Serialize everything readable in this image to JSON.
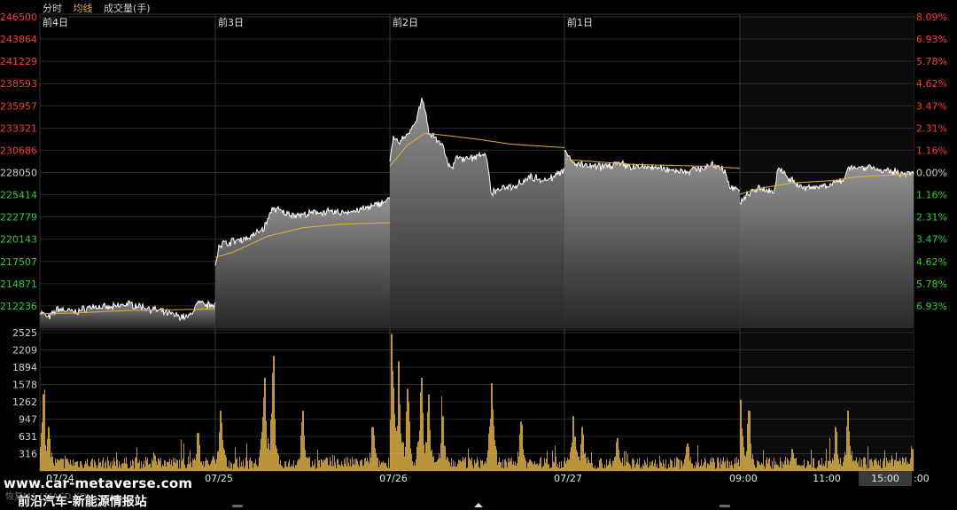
{
  "legend": {
    "tab_fenshi": "分时",
    "tab_avg": "均线",
    "tab_volume": "成交量(手)"
  },
  "colors": {
    "background": "#000000",
    "price_line": "#ffffff",
    "avg_line": "#e0b23c",
    "volume_bar": "#e8b84a",
    "up": "#ff3b3b",
    "down": "#33cc33",
    "neutral": "#cfcfcf",
    "grid": "#2a2a2a"
  },
  "watermark": {
    "line1": "www.car-metaverse.com",
    "line2": "前沿汽车-新能源情报站"
  },
  "faded_text": "恢复MA LMACD KDJ",
  "time_label": "15:00",
  "chart_data": {
    "type": "line",
    "price_axis": {
      "ylim": [
        209600,
        246500
      ],
      "ticks": [
        246500,
        243864,
        241229,
        238593,
        235957,
        233321,
        230686,
        228050,
        225414,
        222779,
        220143,
        217507,
        214871,
        212236
      ],
      "base": 228050
    },
    "pct_axis": {
      "ticks_up": [
        "8.09%",
        "6.93%",
        "5.78%",
        "4.62%",
        "3.47%",
        "2.31%",
        "1.16%"
      ],
      "zero": "0.00%",
      "ticks_down": [
        "1.16%",
        "2.31%",
        "3.47%",
        "4.62%",
        "5.78%",
        "6.93%"
      ]
    },
    "volume_axis": {
      "ylim": [
        0,
        2525
      ],
      "ticks": [
        2525,
        2209,
        1894,
        1578,
        1262,
        947,
        631,
        316
      ]
    },
    "day_labels": [
      "前4日",
      "前3日",
      "前2日",
      "前1日"
    ],
    "date_labels": [
      "07/24",
      "07/25",
      "07/26",
      "07/27"
    ],
    "intraday_labels": [
      "09:00",
      "11:00",
      "15:00"
    ],
    "trailing_label": ":00",
    "days": [
      {
        "price_path": [
          [
            0,
            211600
          ],
          [
            0.05,
            210800
          ],
          [
            0.1,
            211900
          ],
          [
            0.2,
            211500
          ],
          [
            0.3,
            212200
          ],
          [
            0.4,
            212000
          ],
          [
            0.5,
            212500
          ],
          [
            0.6,
            212100
          ],
          [
            0.7,
            211500
          ],
          [
            0.8,
            211000
          ],
          [
            0.85,
            210900
          ],
          [
            0.9,
            212600
          ],
          [
            0.95,
            212300
          ],
          [
            1,
            212600
          ]
        ],
        "avg_path": [
          [
            0,
            211300
          ],
          [
            0.2,
            211400
          ],
          [
            0.5,
            211700
          ],
          [
            0.8,
            211800
          ],
          [
            1,
            211900
          ]
        ],
        "vol_peaks": [
          [
            0.02,
            1400
          ],
          [
            0.05,
            800
          ],
          [
            0.65,
            300
          ],
          [
            0.9,
            700
          ]
        ]
      },
      {
        "price_path": [
          [
            0,
            217000
          ],
          [
            0.02,
            219500
          ],
          [
            0.1,
            219900
          ],
          [
            0.2,
            220400
          ],
          [
            0.28,
            221500
          ],
          [
            0.33,
            223900
          ],
          [
            0.4,
            223200
          ],
          [
            0.5,
            223000
          ],
          [
            0.6,
            223400
          ],
          [
            0.7,
            223300
          ],
          [
            0.8,
            223500
          ],
          [
            0.9,
            224000
          ],
          [
            0.95,
            224500
          ],
          [
            1,
            224900
          ]
        ],
        "avg_path": [
          [
            0,
            218000
          ],
          [
            0.1,
            218600
          ],
          [
            0.3,
            220500
          ],
          [
            0.5,
            221500
          ],
          [
            0.7,
            221900
          ],
          [
            1,
            222100
          ]
        ],
        "vol_peaks": [
          [
            0.03,
            1100
          ],
          [
            0.28,
            1700
          ],
          [
            0.33,
            2100
          ],
          [
            0.5,
            1100
          ],
          [
            0.9,
            800
          ]
        ]
      },
      {
        "price_path": [
          [
            0,
            229700
          ],
          [
            0.02,
            232200
          ],
          [
            0.05,
            231500
          ],
          [
            0.1,
            232400
          ],
          [
            0.15,
            234200
          ],
          [
            0.18,
            236700
          ],
          [
            0.2,
            235600
          ],
          [
            0.22,
            233100
          ],
          [
            0.26,
            232000
          ],
          [
            0.3,
            231600
          ],
          [
            0.33,
            229100
          ],
          [
            0.36,
            228600
          ],
          [
            0.38,
            229800
          ],
          [
            0.45,
            229600
          ],
          [
            0.55,
            230400
          ],
          [
            0.58,
            225600
          ],
          [
            0.6,
            225900
          ],
          [
            0.7,
            226400
          ],
          [
            0.8,
            227500
          ],
          [
            0.9,
            227200
          ],
          [
            1,
            228200
          ]
        ],
        "avg_path": [
          [
            0,
            228800
          ],
          [
            0.1,
            231300
          ],
          [
            0.2,
            232700
          ],
          [
            0.3,
            232500
          ],
          [
            0.5,
            232000
          ],
          [
            0.7,
            231400
          ],
          [
            1,
            231000
          ]
        ],
        "vol_peaks": [
          [
            0.01,
            2500
          ],
          [
            0.05,
            2000
          ],
          [
            0.1,
            1500
          ],
          [
            0.18,
            1700
          ],
          [
            0.22,
            1400
          ],
          [
            0.3,
            1000
          ],
          [
            0.58,
            1600
          ],
          [
            0.75,
            900
          ]
        ]
      },
      {
        "price_path": [
          [
            0,
            230500
          ],
          [
            0.05,
            229200
          ],
          [
            0.1,
            228900
          ],
          [
            0.2,
            228700
          ],
          [
            0.3,
            229100
          ],
          [
            0.4,
            228700
          ],
          [
            0.5,
            228700
          ],
          [
            0.6,
            228400
          ],
          [
            0.7,
            228200
          ],
          [
            0.8,
            228700
          ],
          [
            0.85,
            228900
          ],
          [
            0.9,
            228600
          ],
          [
            0.95,
            226300
          ],
          [
            1,
            226100
          ]
        ],
        "avg_path": [
          [
            0,
            229600
          ],
          [
            0.2,
            229300
          ],
          [
            0.4,
            229000
          ],
          [
            0.6,
            228900
          ],
          [
            0.8,
            228800
          ],
          [
            1,
            228550
          ]
        ],
        "vol_peaks": [
          [
            0.05,
            1000
          ],
          [
            0.1,
            800
          ],
          [
            0.3,
            600
          ],
          [
            0.7,
            500
          ]
        ]
      },
      {
        "price_path": [
          [
            0,
            224300
          ],
          [
            0.05,
            225600
          ],
          [
            0.1,
            226100
          ],
          [
            0.2,
            225800
          ],
          [
            0.22,
            228700
          ],
          [
            0.3,
            227100
          ],
          [
            0.35,
            226300
          ],
          [
            0.4,
            226200
          ],
          [
            0.5,
            226600
          ],
          [
            0.6,
            227000
          ],
          [
            0.62,
            228800
          ],
          [
            0.7,
            228600
          ],
          [
            0.75,
            228800
          ],
          [
            0.8,
            228300
          ],
          [
            0.9,
            228100
          ],
          [
            1,
            227900
          ]
        ],
        "avg_path": [
          [
            0,
            225500
          ],
          [
            0.15,
            226300
          ],
          [
            0.3,
            226800
          ],
          [
            0.45,
            227000
          ],
          [
            0.55,
            227100
          ],
          [
            0.65,
            227500
          ],
          [
            0.8,
            227700
          ],
          [
            1,
            227800
          ]
        ],
        "vol_peaks": [
          [
            0.0,
            1300
          ],
          [
            0.05,
            1100
          ],
          [
            0.3,
            400
          ],
          [
            0.55,
            800
          ],
          [
            0.62,
            1100
          ],
          [
            0.99,
            400
          ]
        ]
      }
    ]
  }
}
